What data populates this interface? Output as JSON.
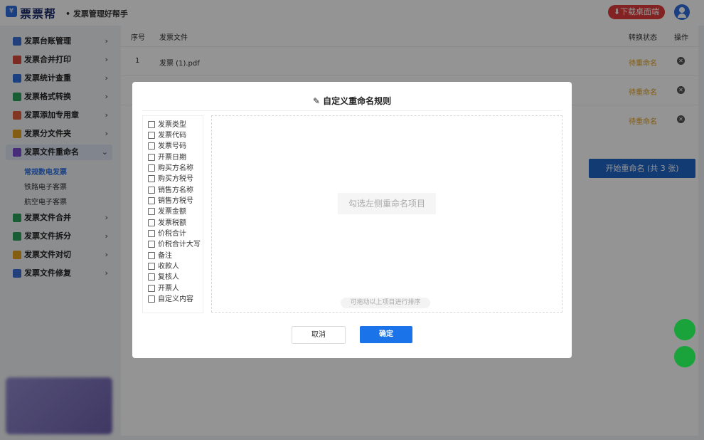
{
  "header": {
    "logo_glyph": "¥",
    "logo_text": "票票帮",
    "slogan": "• 发票管理好帮手",
    "download_label": "⬇下载桌面端"
  },
  "sidebar": {
    "items": [
      {
        "label": "发票台账管理",
        "icon": "ledger-icon",
        "color": "#3b6fd6"
      },
      {
        "label": "发票合并打印",
        "icon": "printer-icon",
        "color": "#d64a3b"
      },
      {
        "label": "发票统计查重",
        "icon": "stats-icon",
        "color": "#2f6fe0"
      },
      {
        "label": "发票格式转换",
        "icon": "convert-icon",
        "color": "#2aa05a"
      },
      {
        "label": "发票添加专用章",
        "icon": "stamp-icon",
        "color": "#e0603b"
      },
      {
        "label": "发票分文件夹",
        "icon": "folder-icon",
        "color": "#e0a020"
      },
      {
        "label": "发票文件重命名",
        "icon": "rename-icon",
        "color": "#7a4fd0"
      },
      {
        "label": "发票文件合并",
        "icon": "merge-icon",
        "color": "#2aa05a"
      },
      {
        "label": "发票文件拆分",
        "icon": "split-icon",
        "color": "#2aa05a"
      },
      {
        "label": "发票文件对切",
        "icon": "cut-icon",
        "color": "#e0a020"
      },
      {
        "label": "发票文件修复",
        "icon": "repair-icon",
        "color": "#3b6fd6"
      }
    ],
    "subitems": [
      "常规数电发票",
      "铁路电子客票",
      "航空电子客票"
    ]
  },
  "table": {
    "headers": {
      "index": "序号",
      "file": "发票文件",
      "status": "转换状态",
      "action": "操作"
    },
    "rows": [
      {
        "index": "1",
        "file": "发票 (1).pdf",
        "status": "待重命名"
      },
      {
        "index": "",
        "file": "",
        "status": "待重命名"
      },
      {
        "index": "",
        "file": "",
        "status": "待重命名"
      }
    ],
    "delete_glyph": "✕",
    "start_label": "开始重命名 (共 3 张)"
  },
  "modal": {
    "title": "✎ 自定义重命名规则",
    "options": [
      "发票类型",
      "发票代码",
      "发票号码",
      "开票日期",
      "购买方名称",
      "购买方税号",
      "销售方名称",
      "销售方税号",
      "发票金额",
      "发票税额",
      "价税合计",
      "价税合计大写",
      "备注",
      "收款人",
      "复核人",
      "开票人",
      "自定义内容"
    ],
    "drop_hint": "勾选左侧重命名项目",
    "sort_hint": "可拖动以上项目进行排序",
    "cancel_label": "取消",
    "ok_label": "确定"
  }
}
